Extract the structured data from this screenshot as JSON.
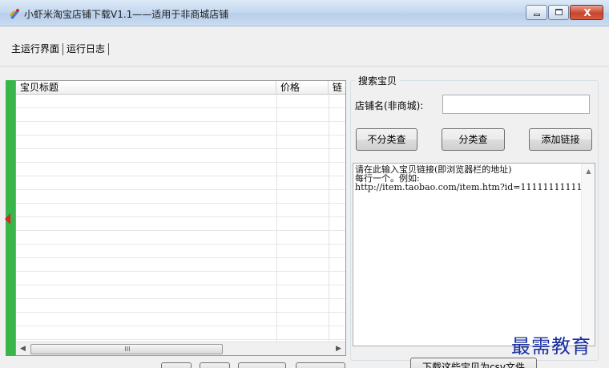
{
  "window": {
    "title": "小虾米淘宝店铺下载V1.1——适用于非商城店铺",
    "controls": {
      "minimize": "",
      "maximize": "",
      "close": "X"
    }
  },
  "tabs": [
    {
      "label": "主运行界面",
      "active": true
    },
    {
      "label": "运行日志",
      "active": false
    }
  ],
  "item_list": {
    "columns": [
      "宝贝标题",
      "价格",
      "链"
    ],
    "rows": [],
    "scrollbar_grip": "III"
  },
  "search_group": {
    "title": "搜索宝贝",
    "shop_name_label": "店铺名(非商城):",
    "shop_name_value": "",
    "buttons": {
      "no_category": "不分类查",
      "by_category": "分类查",
      "add_link": "添加链接"
    },
    "links_text": "请在此输入宝贝链接(即浏览器栏的地址)\n每行一个。例如:\nhttp://item.taobao.com/item.htm?id=11111111111"
  },
  "export_button": "下载这些宝贝为csv文件",
  "watermark": "最需教育",
  "colors": {
    "side_bar": "#39b54a",
    "side_arrow": "#d8232a",
    "watermark": "#1a2fa0"
  }
}
